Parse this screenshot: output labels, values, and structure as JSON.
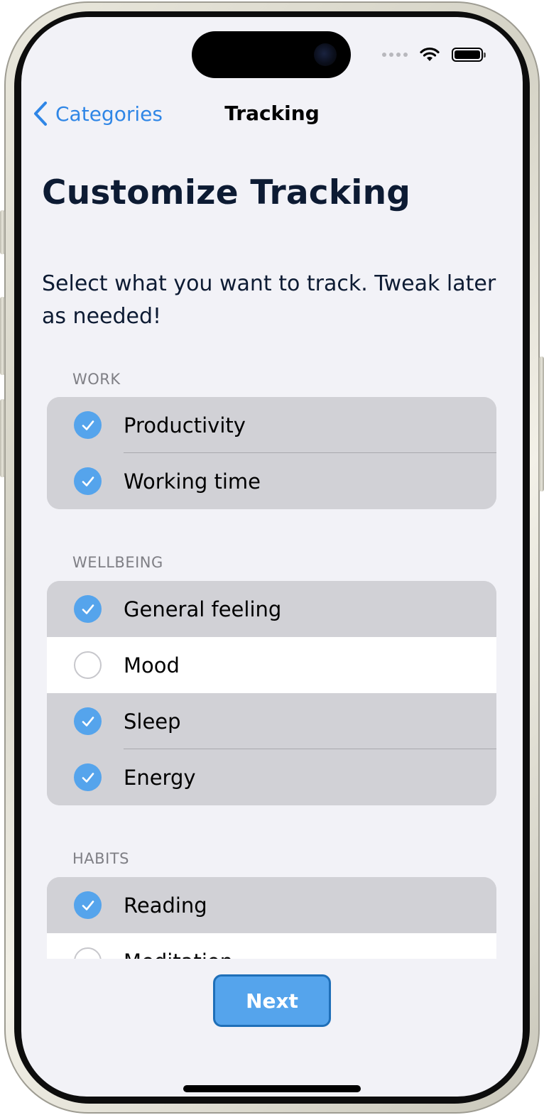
{
  "nav": {
    "back_label": "Categories",
    "title": "Tracking"
  },
  "header": {
    "title": "Customize Tracking",
    "subtitle": "Select what you want to track. Tweak later as needed!"
  },
  "sections": [
    {
      "title": "WORK",
      "items": [
        {
          "label": "Productivity",
          "checked": true
        },
        {
          "label": "Working time",
          "checked": true
        }
      ]
    },
    {
      "title": "WELLBEING",
      "items": [
        {
          "label": "General feeling",
          "checked": true
        },
        {
          "label": "Mood",
          "checked": false
        },
        {
          "label": "Sleep",
          "checked": true
        },
        {
          "label": "Energy",
          "checked": true
        }
      ]
    },
    {
      "title": "HABITS",
      "items": [
        {
          "label": "Reading",
          "checked": true
        },
        {
          "label": "Meditation",
          "checked": false
        }
      ]
    }
  ],
  "footer": {
    "next_label": "Next"
  },
  "colors": {
    "accent": "#2f86e6",
    "check_fill": "#55a4ec",
    "selected_row": "#d1d1d6",
    "unselected_row": "#ffffff",
    "background": "#f2f2f7",
    "title_text": "#0d1b33"
  },
  "icons": {
    "back": "chevron-left-icon",
    "wifi": "wifi-icon",
    "battery": "battery-icon",
    "checked": "checkmark-circle-icon",
    "unchecked": "empty-circle-icon"
  }
}
